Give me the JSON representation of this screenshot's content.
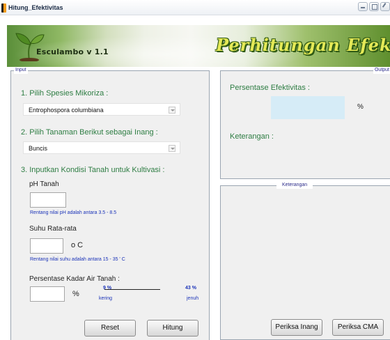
{
  "window": {
    "title": "Hitung_Efektivitas"
  },
  "banner": {
    "version": "Esculambo v 1.1",
    "heading": "Perhitungan Efektivitas"
  },
  "input_panel": {
    "title": "Input",
    "step1_label": "1. Pilih Spesies Mikoriza :",
    "species_selected": "Entrophospora columbiana",
    "step2_label": "2. Pilih Tanaman Berikut sebagai Inang :",
    "plant_selected": "Buncis",
    "step3_label": "3. Inputkan Kondisi Tanah untuk Kultivasi :",
    "ph_label": "pH Tanah",
    "ph_value": "",
    "ph_note": "Rentang nilai pH adalah antara 3.5 - 8.5",
    "temp_label": "Suhu Rata-rata",
    "temp_value": "",
    "temp_unit": "o C",
    "temp_note": "Rentang nilai suhu adalah antara 15 - 35 ' C",
    "water_label": "Persentase Kadar Air Tanah :",
    "water_value": "",
    "water_unit": "%",
    "range_min": "9 %",
    "range_max": "43 %",
    "range_min_label": "kering",
    "range_max_label": "jenuh",
    "reset_label": "Reset",
    "hitung_label": "Hitung"
  },
  "output_panel": {
    "title": "Output",
    "persentase_label": "Persentase Efektivitas :",
    "persentase_value": "",
    "percent_sign": "%",
    "keterangan_label": "Keterangan :"
  },
  "keterangan_panel": {
    "title": "Keterangan",
    "periksa_inang_label": "Periksa Inang",
    "periksa_cma_label": "Periksa CMA"
  },
  "colors": {
    "section_green": "#2e7d43",
    "note_blue": "#1b33b8",
    "result_bg": "#d6ecf7",
    "banner_heading": "#e4e957"
  }
}
